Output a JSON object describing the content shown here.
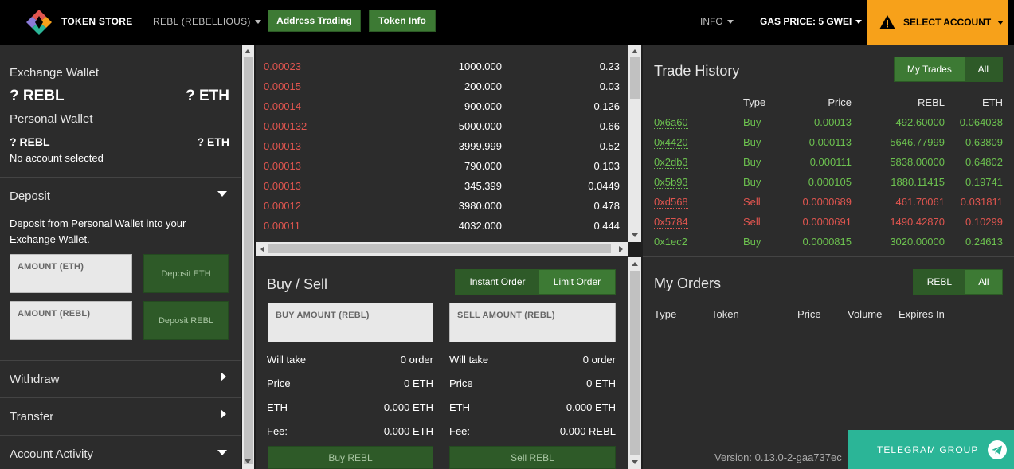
{
  "topbar": {
    "brand": "TOKEN STORE",
    "token_select": "REBL (REBELLIOUS)",
    "address_trading": "Address Trading",
    "token_info": "Token Info",
    "info": "INFO",
    "gas_price": "GAS PRICE: 5 GWEI",
    "select_account": "SELECT ACCOUNT",
    "accent_color": "#f7a11a"
  },
  "wallet": {
    "exchange_title": "Exchange Wallet",
    "exchange_rebl": "? REBL",
    "exchange_eth": "? ETH",
    "personal_title": "Personal Wallet",
    "personal_rebl": "? REBL",
    "personal_eth": "? ETH",
    "no_account": "No account selected"
  },
  "deposit": {
    "title": "Deposit",
    "description": "Deposit from Personal Wallet into your Exchange Wallet.",
    "amount_eth_placeholder": "AMOUNT (ETH)",
    "amount_rebl_placeholder": "AMOUNT (REBL)",
    "deposit_eth": "Deposit ETH",
    "deposit_rebl": "Deposit REBL"
  },
  "sections": {
    "withdraw": "Withdraw",
    "transfer": "Transfer",
    "account_activity": "Account Activity"
  },
  "orderbook": {
    "rows": [
      {
        "price": "0.00023",
        "amount": "1000.000",
        "total": "0.23"
      },
      {
        "price": "0.00015",
        "amount": "200.000",
        "total": "0.03"
      },
      {
        "price": "0.00014",
        "amount": "900.000",
        "total": "0.126"
      },
      {
        "price": "0.000132",
        "amount": "5000.000",
        "total": "0.66"
      },
      {
        "price": "0.00013",
        "amount": "3999.999",
        "total": "0.52"
      },
      {
        "price": "0.00013",
        "amount": "790.000",
        "total": "0.103"
      },
      {
        "price": "0.00013",
        "amount": "345.399",
        "total": "0.0449"
      },
      {
        "price": "0.00012",
        "amount": "3980.000",
        "total": "0.478"
      },
      {
        "price": "0.00011",
        "amount": "4032.000",
        "total": "0.444"
      }
    ]
  },
  "buysell": {
    "title": "Buy / Sell",
    "instant_order": "Instant Order",
    "limit_order": "Limit Order",
    "buy_amount_placeholder": "BUY AMOUNT (REBL)",
    "sell_amount_placeholder": "SELL AMOUNT (REBL)",
    "buy": {
      "will_take_label": "Will take",
      "will_take_value": "0 order",
      "price_label": "Price",
      "price_value": "0 ETH",
      "eth_label": "ETH",
      "eth_value": "0.000 ETH",
      "fee_label": "Fee:",
      "fee_value": "0.000 ETH",
      "button": "Buy REBL"
    },
    "sell": {
      "will_take_label": "Will take",
      "will_take_value": "0 order",
      "price_label": "Price",
      "price_value": "0 ETH",
      "eth_label": "ETH",
      "eth_value": "0.000 ETH",
      "fee_label": "Fee:",
      "fee_value": "0.000 REBL",
      "button": "Sell REBL"
    }
  },
  "trade_history": {
    "title": "Trade History",
    "my_trades": "My Trades",
    "all": "All",
    "headers": {
      "type": "Type",
      "price": "Price",
      "rebl": "REBL",
      "eth": "ETH"
    },
    "rows": [
      {
        "addr": "0x6a60",
        "type": "Buy",
        "price": "0.00013",
        "rebl": "492.60000",
        "eth": "0.064038"
      },
      {
        "addr": "0x4420",
        "type": "Buy",
        "price": "0.000113",
        "rebl": "5646.77999",
        "eth": "0.63809"
      },
      {
        "addr": "0x2db3",
        "type": "Buy",
        "price": "0.000111",
        "rebl": "5838.00000",
        "eth": "0.64802"
      },
      {
        "addr": "0x5b93",
        "type": "Buy",
        "price": "0.000105",
        "rebl": "1880.11415",
        "eth": "0.19741"
      },
      {
        "addr": "0xd568",
        "type": "Sell",
        "price": "0.0000689",
        "rebl": "461.70061",
        "eth": "0.031811"
      },
      {
        "addr": "0x5784",
        "type": "Sell",
        "price": "0.0000691",
        "rebl": "1490.42870",
        "eth": "0.10299"
      },
      {
        "addr": "0x1ec2",
        "type": "Buy",
        "price": "0.0000815",
        "rebl": "3020.00000",
        "eth": "0.24613"
      }
    ]
  },
  "my_orders": {
    "title": "My Orders",
    "rebl": "REBL",
    "all": "All",
    "headers": {
      "type": "Type",
      "token": "Token",
      "price": "Price",
      "volume": "Volume",
      "expires": "Expires In"
    }
  },
  "footer": {
    "version": "Version: 0.13.0-2-gaa737ec",
    "telegram": "TELEGRAM GROUP"
  }
}
